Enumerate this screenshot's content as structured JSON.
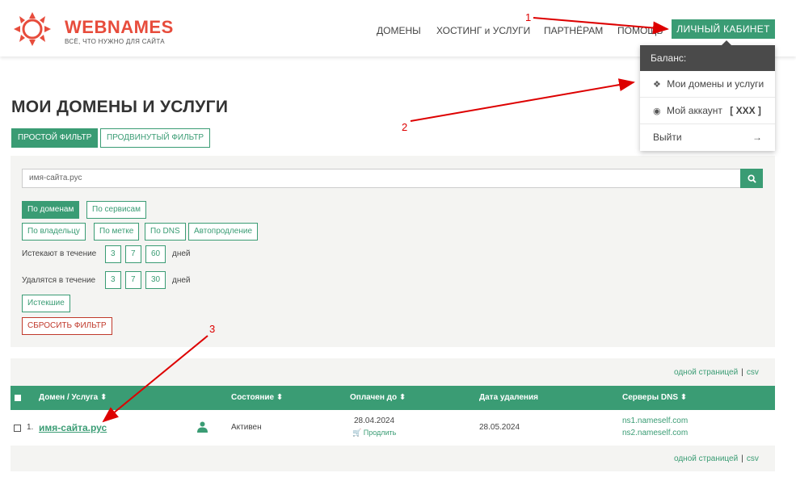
{
  "header": {
    "logo_text": "WEBNAMES",
    "logo_tagline": "ВСЁ, ЧТО НУЖНО ДЛЯ САЙТА",
    "nav": [
      "ДОМЕНЫ",
      "ХОСТИНГ и УСЛУГИ",
      "ПАРТНЁРАМ",
      "ПОМОЩЬ"
    ],
    "cabinet_button": "ЛИЧНЫЙ КАБИНЕТ"
  },
  "dropdown": {
    "balance": "Баланс:",
    "items": [
      {
        "label": "Мои домены и услуги",
        "icon": "cubes-icon"
      },
      {
        "label": "Мой аккаунт",
        "badge": "[ XXX ]",
        "icon": "user-circle-icon"
      },
      {
        "label": "Выйти",
        "icon": "sign-out-icon"
      }
    ]
  },
  "page": {
    "title": "МОИ ДОМЕНЫ И УСЛУГИ",
    "tabs": [
      "ПРОСТОЙ ФИЛЬТР",
      "ПРОДВИНУТЫЙ ФИЛЬТР"
    ]
  },
  "filter": {
    "search_value": "имя-сайта.рус",
    "group1": [
      "По доменам",
      "По сервисам"
    ],
    "group2": [
      "По владельцу",
      "По метке",
      "По DNS",
      "Автопродление"
    ],
    "expire_label": "Истекают в течение",
    "expire_options": [
      "3",
      "7",
      "60"
    ],
    "delete_label": "Удалятся в течение",
    "delete_options": [
      "3",
      "7",
      "30"
    ],
    "days_label": "дней",
    "expired_button": "Истекшие",
    "reset_button": "СБРОСИТЬ ФИЛЬТР"
  },
  "table": {
    "one_page_link": "одной страницей",
    "separator": "|",
    "csv_link": "csv",
    "columns": [
      "Домен / Услуга ⬍",
      "Состояние ⬍",
      "Оплачен до ⬍",
      "Дата удаления",
      "Серверы DNS ⬍"
    ],
    "rows": [
      {
        "num": "1.",
        "domain": "имя-сайта.рус",
        "status": "Активен",
        "paid_until": "28.04.2024",
        "renew": "Продлить",
        "delete_date": "28.05.2024",
        "dns1": "ns1.nameself.com",
        "dns2": "ns2.nameself.com"
      }
    ]
  },
  "annotations": [
    "1",
    "2",
    "3"
  ],
  "colors": {
    "accent": "#3a9c74",
    "logo": "#e74c3c",
    "arrow": "#dd0000"
  }
}
